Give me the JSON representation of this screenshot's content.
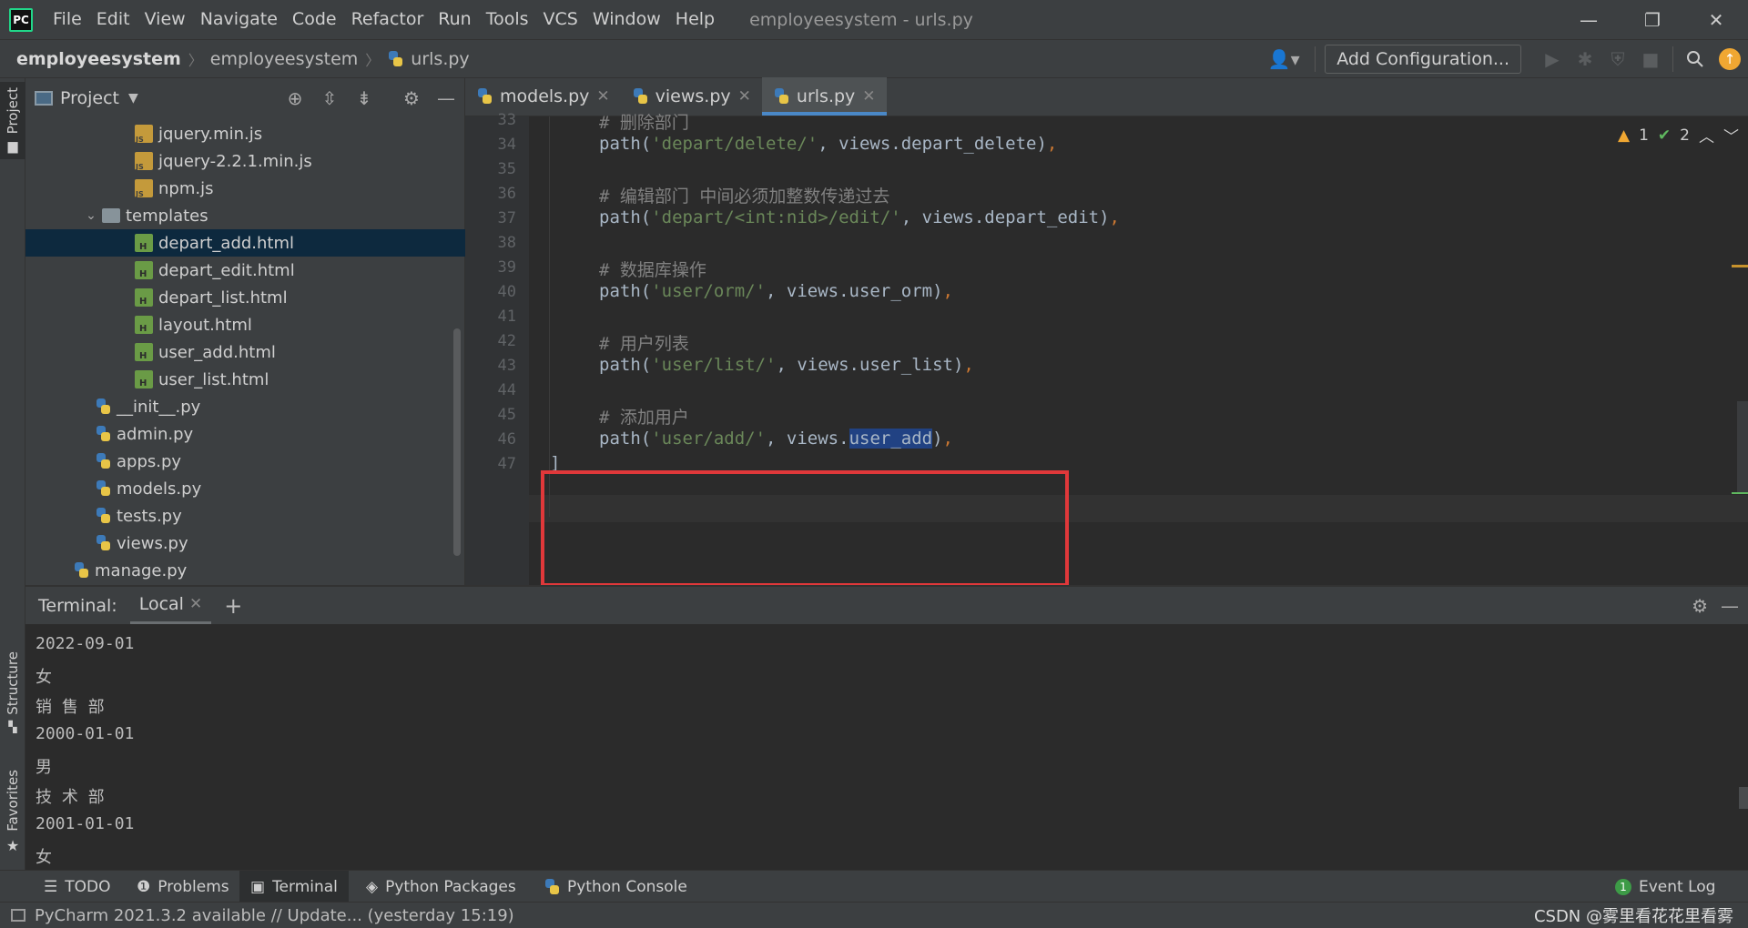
{
  "app": {
    "logo_text": "PC",
    "window_title": "employeesystem - urls.py"
  },
  "menu": [
    "File",
    "Edit",
    "View",
    "Navigate",
    "Code",
    "Refactor",
    "Run",
    "Tools",
    "VCS",
    "Window",
    "Help"
  ],
  "window_controls": {
    "minimize": "—",
    "restore": "❐",
    "close": "✕"
  },
  "breadcrumb": {
    "project": "employeesystem",
    "folder": "employeesystem",
    "file": "urls.py"
  },
  "toolbar": {
    "add_configuration": "Add Configuration..."
  },
  "left_strip": {
    "project": "Project",
    "structure": "Structure",
    "favorites": "Favorites"
  },
  "project_panel": {
    "title": "Project",
    "tree": [
      {
        "label": "jquery.min.js",
        "type": "js",
        "indent": 3
      },
      {
        "label": "jquery-2.2.1.min.js",
        "type": "js",
        "indent": 3
      },
      {
        "label": "npm.js",
        "type": "js",
        "indent": 3
      },
      {
        "label": "templates",
        "type": "folder",
        "indent": 2
      },
      {
        "label": "depart_add.html",
        "type": "html",
        "indent": 3,
        "selected": true
      },
      {
        "label": "depart_edit.html",
        "type": "html",
        "indent": 3
      },
      {
        "label": "depart_list.html",
        "type": "html",
        "indent": 3
      },
      {
        "label": "layout.html",
        "type": "html",
        "indent": 3
      },
      {
        "label": "user_add.html",
        "type": "html",
        "indent": 3
      },
      {
        "label": "user_list.html",
        "type": "html",
        "indent": 3
      },
      {
        "label": "__init__.py",
        "type": "py",
        "indent": 2
      },
      {
        "label": "admin.py",
        "type": "py",
        "indent": 2
      },
      {
        "label": "apps.py",
        "type": "py",
        "indent": 2
      },
      {
        "label": "models.py",
        "type": "py",
        "indent": 2
      },
      {
        "label": "tests.py",
        "type": "py",
        "indent": 2
      },
      {
        "label": "views.py",
        "type": "py",
        "indent": 2
      },
      {
        "label": "manage.py",
        "type": "py",
        "indent": 1
      }
    ]
  },
  "editor": {
    "tabs": [
      {
        "label": "models.py",
        "active": false
      },
      {
        "label": "views.py",
        "active": false
      },
      {
        "label": "urls.py",
        "active": true
      }
    ],
    "inspections": {
      "warnings": "1",
      "ok": "2"
    },
    "lines": [
      {
        "num": "33",
        "parts": [
          {
            "t": "# 删除部门",
            "c": "cm"
          }
        ]
      },
      {
        "num": "34",
        "parts": [
          {
            "t": "path(",
            "c": ""
          },
          {
            "t": "'depart/delete/'",
            "c": "str"
          },
          {
            "t": ", views.depart_delete)",
            "c": ""
          },
          {
            "t": ",",
            "c": "kw"
          }
        ]
      },
      {
        "num": "35",
        "parts": []
      },
      {
        "num": "36",
        "parts": [
          {
            "t": "# 编辑部门 中间必须加整数传递过去",
            "c": "cm"
          }
        ]
      },
      {
        "num": "37",
        "parts": [
          {
            "t": "path(",
            "c": ""
          },
          {
            "t": "'depart/<int:nid>/edit/'",
            "c": "str"
          },
          {
            "t": ", views.depart_edit)",
            "c": ""
          },
          {
            "t": ",",
            "c": "kw"
          }
        ]
      },
      {
        "num": "38",
        "parts": []
      },
      {
        "num": "39",
        "parts": [
          {
            "t": "# 数据库操作",
            "c": "cm"
          }
        ]
      },
      {
        "num": "40",
        "parts": [
          {
            "t": "path(",
            "c": ""
          },
          {
            "t": "'user/orm/'",
            "c": "str"
          },
          {
            "t": ", views.user_orm)",
            "c": ""
          },
          {
            "t": ",",
            "c": "kw"
          }
        ]
      },
      {
        "num": "41",
        "parts": []
      },
      {
        "num": "42",
        "parts": [
          {
            "t": "# 用户列表",
            "c": "cm"
          }
        ]
      },
      {
        "num": "43",
        "parts": [
          {
            "t": "path(",
            "c": ""
          },
          {
            "t": "'user/list/'",
            "c": "str"
          },
          {
            "t": ", views.user_list)",
            "c": ""
          },
          {
            "t": ",",
            "c": "kw"
          }
        ]
      },
      {
        "num": "44",
        "parts": []
      },
      {
        "num": "45",
        "parts": [
          {
            "t": "# 添加用户",
            "c": "cm"
          }
        ]
      },
      {
        "num": "46",
        "parts": [
          {
            "t": "path(",
            "c": ""
          },
          {
            "t": "'user/add/'",
            "c": "str"
          },
          {
            "t": ", views.",
            "c": ""
          },
          {
            "t": "user_add",
            "c": "sel-text"
          },
          {
            "t": ")",
            "c": ""
          },
          {
            "t": ",",
            "c": "kw"
          }
        ]
      },
      {
        "num": "47",
        "parts": [
          {
            "t": "]",
            "c": ""
          }
        ]
      }
    ]
  },
  "terminal": {
    "label": "Terminal:",
    "tab": "Local",
    "lines": [
      "2022-09-01",
      "女",
      "销 售 部",
      "2000-01-01",
      "男",
      "技 术 部",
      "2001-01-01",
      "女"
    ]
  },
  "bottom_tabs": [
    "TODO",
    "Problems",
    "Terminal",
    "Python Packages",
    "Python Console"
  ],
  "event_log": {
    "count": "1",
    "label": "Event Log"
  },
  "status": {
    "message": "PyCharm 2021.3.2 available // Update... (yesterday 15:19)",
    "right": "CSDN @雾里看花花里看雾"
  },
  "colors": {
    "highlight_box": "#e0383a",
    "selection": "#214283",
    "tree_selection": "#0d293e"
  }
}
